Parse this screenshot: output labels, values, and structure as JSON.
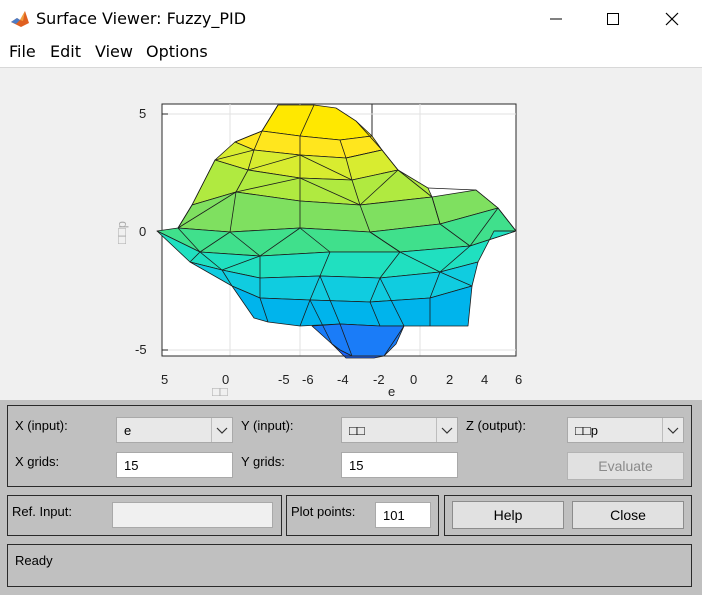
{
  "window": {
    "title": "Surface Viewer: Fuzzy_PID",
    "icon": "matlab-membrane-icon",
    "buttons": [
      "minimize-icon",
      "maximize-icon",
      "close-icon"
    ]
  },
  "menu": [
    "File",
    "Edit",
    "View",
    "Options"
  ],
  "plot": {
    "z_ticks": [
      "5",
      "0",
      "-5"
    ],
    "z_label": "□□p",
    "x_ticks": [
      "-5",
      "-6",
      "-4",
      "-2",
      "0",
      "2",
      "4",
      "6"
    ],
    "x_label": "e",
    "y_ticks": [
      "5",
      "0"
    ],
    "y_label": "□□",
    "surface_colors": [
      "#1a64ff",
      "#00b0e0",
      "#20e0c0",
      "#7fe060",
      "#d8ec30",
      "#ffe800"
    ]
  },
  "controls": {
    "x_input_label": "X (input):",
    "x_input_value": "e",
    "y_input_label": "Y (input):",
    "y_input_value": "□□",
    "z_output_label": "Z (output):",
    "z_output_value": "□□p",
    "x_grids_label": "X grids:",
    "x_grids_value": "15",
    "y_grids_label": "Y grids:",
    "y_grids_value": "15",
    "evaluate_label": "Evaluate",
    "ref_input_label": "Ref. Input:",
    "ref_input_value": "",
    "plot_points_label": "Plot points:",
    "plot_points_value": "101",
    "help_label": "Help",
    "close_label": "Close",
    "status": "Ready"
  }
}
